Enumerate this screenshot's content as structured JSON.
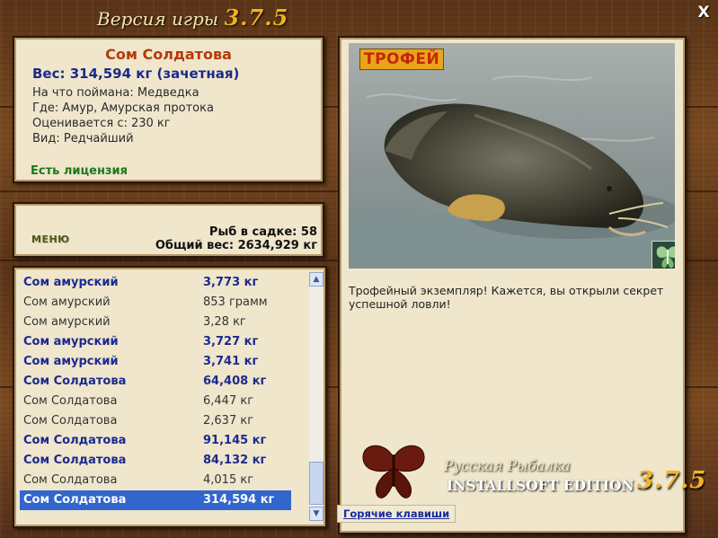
{
  "header": {
    "version_label": "Версия игры",
    "version_number": "3.7.5",
    "close_label": "X"
  },
  "fish_info": {
    "name": "Сом Солдатова",
    "weight": "Вес: 314,594 кг (зачетная)",
    "bait": "На что поймана: Медведка",
    "location": "Где: Амур, Амурская протока",
    "rated_from": "Оценивается с: 230 кг",
    "species_rarity": "Вид: Редчайший",
    "license": "Есть лицензия"
  },
  "cage": {
    "menu_label": "МЕНЮ",
    "fish_count": "Рыб в садке: 58",
    "total_weight": "Общий вес: 2634,929 кг"
  },
  "catch_list": [
    {
      "name": "Сом амурский",
      "weight": "3,773 кг",
      "bold": true
    },
    {
      "name": "Сом амурский",
      "weight": "853 грамм",
      "bold": false
    },
    {
      "name": "Сом амурский",
      "weight": "3,28 кг",
      "bold": false
    },
    {
      "name": "Сом амурский",
      "weight": "3,727 кг",
      "bold": true
    },
    {
      "name": "Сом амурский",
      "weight": "3,741 кг",
      "bold": true
    },
    {
      "name": "Сом Солдатова",
      "weight": "64,408 кг",
      "bold": true
    },
    {
      "name": "Сом Солдатова",
      "weight": "6,447 кг",
      "bold": false
    },
    {
      "name": "Сом Солдатова",
      "weight": "2,637 кг",
      "bold": false
    },
    {
      "name": "Сом Солдатова",
      "weight": "91,145 кг",
      "bold": true
    },
    {
      "name": "Сом Солдатова",
      "weight": "84,132 кг",
      "bold": true
    },
    {
      "name": "Сом Солдатова",
      "weight": "4,015 кг",
      "bold": false
    },
    {
      "name": "Сом Солдатова",
      "weight": "314,594 кг",
      "bold": true,
      "selected": true
    }
  ],
  "trophy": {
    "badge": "ТРОФЕЙ",
    "message": "Трофейный экземпляр! Кажется, вы открыли секрет успешной ловли!"
  },
  "brand": {
    "title": "Русская Рыбалка",
    "edition": "INSTALLSOFT EDITION",
    "version": "3.7.5"
  },
  "footer": {
    "hotkeys_label": "Горячие клавиши"
  },
  "icons": {
    "close": "close-icon",
    "logo": "butterfly-logo-icon",
    "scroll_up": "scroll-up-icon",
    "scroll_down": "scroll-down-icon"
  }
}
